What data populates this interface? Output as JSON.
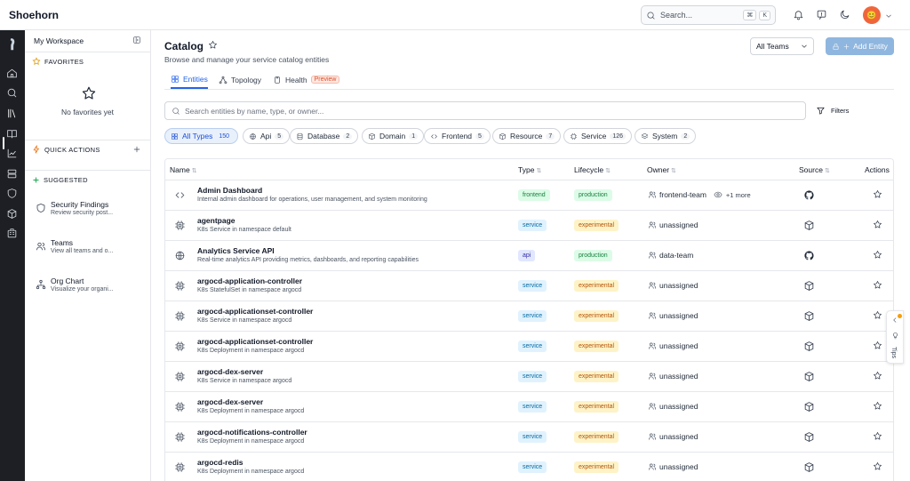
{
  "app": {
    "title": "Shoehorn"
  },
  "topbar": {
    "search_label": "Search...",
    "kbd": [
      "⌘",
      "K"
    ],
    "avatar_text": "😊"
  },
  "sidebar": {
    "workspace_title": "My Workspace",
    "favorites": {
      "header": "FAVORITES",
      "empty": "No favorites yet"
    },
    "quick_actions": {
      "header": "QUICK ACTIONS"
    },
    "suggested": {
      "header": "SUGGESTED",
      "items": [
        {
          "title": "Security Findings",
          "subtitle": "Review security post...",
          "icon": "shield-icon"
        },
        {
          "title": "Teams",
          "subtitle": "View all teams and o...",
          "icon": "users-icon"
        },
        {
          "title": "Org Chart",
          "subtitle": "Visualize your organi...",
          "icon": "org-chart-icon"
        }
      ]
    }
  },
  "main": {
    "title": "Catalog",
    "subtitle": "Browse and manage your service catalog entities",
    "team_select": "All Teams",
    "add_label": "Add Entity",
    "tabs": [
      {
        "label": "Entities",
        "active": true
      },
      {
        "label": "Topology"
      },
      {
        "label": "Health",
        "badge": "Preview"
      }
    ],
    "search_placeholder": "Search entities by name, type, or owner...",
    "filters_label": "Filters",
    "chips": [
      {
        "label": "All Types",
        "count": "150",
        "active": true
      },
      {
        "label": "Api",
        "count": "5"
      },
      {
        "label": "Database",
        "count": "2"
      },
      {
        "label": "Domain",
        "count": "1"
      },
      {
        "label": "Frontend",
        "count": "5"
      },
      {
        "label": "Resource",
        "count": "7"
      },
      {
        "label": "Service",
        "count": "126"
      },
      {
        "label": "System",
        "count": "2"
      }
    ],
    "table": {
      "columns": [
        "Name",
        "Type",
        "Lifecycle",
        "Owner",
        "Source",
        "Actions"
      ],
      "rows": [
        {
          "name": "Admin Dashboard",
          "desc": "Internal admin dashboard for operations, user management, and system monitoring",
          "type": "frontend",
          "lifecycle": "production",
          "owner": "frontend-team",
          "more": "+1 more",
          "source": "github",
          "icon": "code"
        },
        {
          "name": "agentpage",
          "desc": "K8s Service in namespace default",
          "type": "service",
          "lifecycle": "experimental",
          "owner": "unassigned",
          "source": "k8s",
          "icon": "chip"
        },
        {
          "name": "Analytics Service API",
          "desc": "Real-time analytics API providing metrics, dashboards, and reporting capabilities",
          "type": "api",
          "lifecycle": "production",
          "owner": "data-team",
          "source": "github",
          "icon": "globe"
        },
        {
          "name": "argocd-application-controller",
          "desc": "K8s StatefulSet in namespace argocd",
          "type": "service",
          "lifecycle": "experimental",
          "owner": "unassigned",
          "source": "k8s",
          "icon": "chip"
        },
        {
          "name": "argocd-applicationset-controller",
          "desc": "K8s Service in namespace argocd",
          "type": "service",
          "lifecycle": "experimental",
          "owner": "unassigned",
          "source": "k8s",
          "icon": "chip"
        },
        {
          "name": "argocd-applicationset-controller",
          "desc": "K8s Deployment in namespace argocd",
          "type": "service",
          "lifecycle": "experimental",
          "owner": "unassigned",
          "source": "k8s",
          "icon": "chip"
        },
        {
          "name": "argocd-dex-server",
          "desc": "K8s Service in namespace argocd",
          "type": "service",
          "lifecycle": "experimental",
          "owner": "unassigned",
          "source": "k8s",
          "icon": "chip"
        },
        {
          "name": "argocd-dex-server",
          "desc": "K8s Deployment in namespace argocd",
          "type": "service",
          "lifecycle": "experimental",
          "owner": "unassigned",
          "source": "k8s",
          "icon": "chip"
        },
        {
          "name": "argocd-notifications-controller",
          "desc": "K8s Deployment in namespace argocd",
          "type": "service",
          "lifecycle": "experimental",
          "owner": "unassigned",
          "source": "k8s",
          "icon": "chip"
        },
        {
          "name": "argocd-redis",
          "desc": "K8s Deployment in namespace argocd",
          "type": "service",
          "lifecycle": "experimental",
          "owner": "unassigned",
          "source": "k8s",
          "icon": "chip"
        }
      ]
    }
  },
  "tips": {
    "label": "Tips"
  },
  "colors": {
    "accent": "#2563eb",
    "rail": "#1d1f24",
    "add_button": "#8fb6de",
    "avatar": "#f0663b"
  }
}
